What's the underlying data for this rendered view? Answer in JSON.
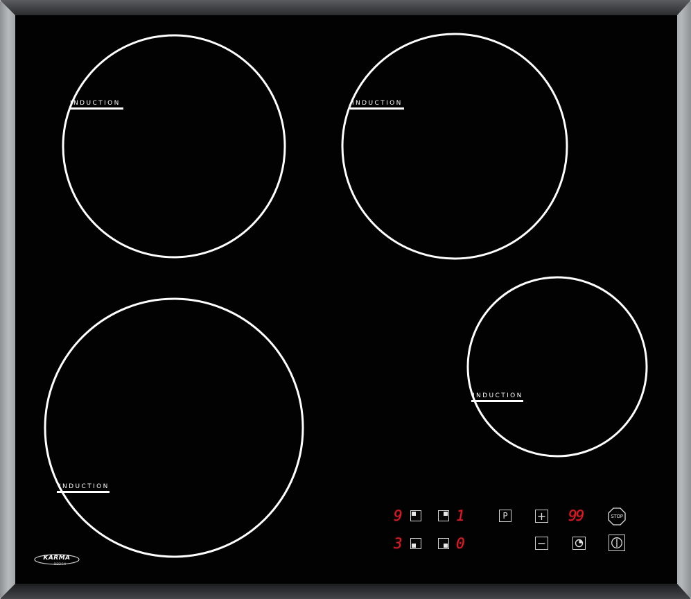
{
  "zones": [
    {
      "id": "rear-left",
      "label": "INDUCTION"
    },
    {
      "id": "rear-right",
      "label": "INDUCTION"
    },
    {
      "id": "front-left",
      "label": "INDUCTION"
    },
    {
      "id": "front-right",
      "label": "INDUCTION"
    }
  ],
  "displays": {
    "rear_left_level": "9",
    "front_left_level": "3",
    "rear_right_level": "1",
    "front_right_level": "0",
    "timer": "99"
  },
  "controls": {
    "program_label": "P",
    "plus_symbol": "+",
    "minus_symbol": "−",
    "stop_label": "STOP"
  },
  "brand": {
    "name": "KARMA",
    "sub": "DESIGN"
  },
  "colors": {
    "glass": "#020203",
    "frame": "#9a9da0",
    "zone_ring": "#ffffff",
    "display_red": "#d0202a"
  },
  "icons": [
    "timer-icon",
    "power-icon",
    "stop-icon"
  ]
}
